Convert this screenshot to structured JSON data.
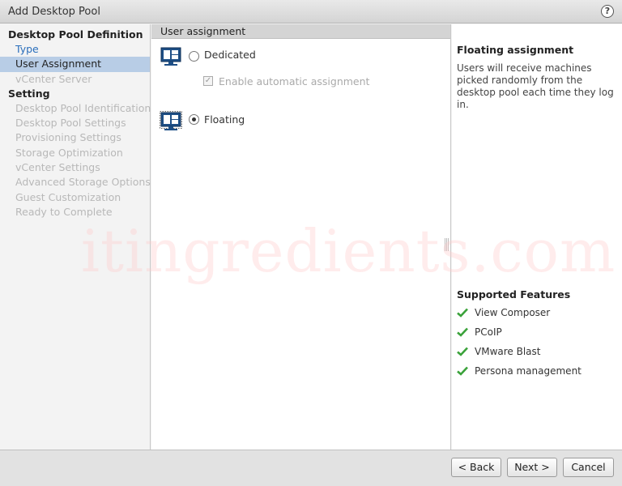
{
  "window": {
    "title": "Add Desktop Pool",
    "help_label": "?"
  },
  "nav": {
    "sections": [
      {
        "label": "Desktop Pool Definition",
        "items": [
          {
            "label": "Type",
            "state": "link"
          },
          {
            "label": "User Assignment",
            "state": "active"
          },
          {
            "label": "vCenter Server",
            "state": "disabled"
          }
        ]
      },
      {
        "label": "Setting",
        "items": [
          {
            "label": "Desktop Pool Identification",
            "state": "disabled"
          },
          {
            "label": "Desktop Pool Settings",
            "state": "disabled"
          },
          {
            "label": "Provisioning Settings",
            "state": "disabled"
          },
          {
            "label": "Storage Optimization",
            "state": "disabled"
          },
          {
            "label": "vCenter Settings",
            "state": "disabled"
          },
          {
            "label": "Advanced Storage Options",
            "state": "disabled"
          },
          {
            "label": "Guest Customization",
            "state": "disabled"
          },
          {
            "label": "Ready to Complete",
            "state": "disabled"
          }
        ]
      }
    ]
  },
  "center": {
    "header": "User assignment",
    "options": [
      {
        "label": "Dedicated",
        "selected": false,
        "icon": "desktop-dedicated-icon"
      },
      {
        "label": "Floating",
        "selected": true,
        "icon": "desktop-floating-icon"
      }
    ],
    "auto_assign": {
      "label": "Enable automatic assignment",
      "checked": true,
      "enabled": false
    }
  },
  "right": {
    "title": "Floating assignment",
    "description": "Users will receive machines picked randomly from the desktop pool each time they log in.",
    "features_title": "Supported Features",
    "features": [
      "View Composer",
      "PCoIP",
      "VMware Blast",
      "Persona management"
    ]
  },
  "watermark": "itingredients.com",
  "footer": {
    "back_label": "< Back",
    "next_label": "Next >",
    "cancel_label": "Cancel"
  },
  "colors": {
    "link": "#2a6ebb",
    "active_row": "#b8cde6",
    "check_green": "#3aa23a",
    "icon_blue": "#1e4f86"
  }
}
